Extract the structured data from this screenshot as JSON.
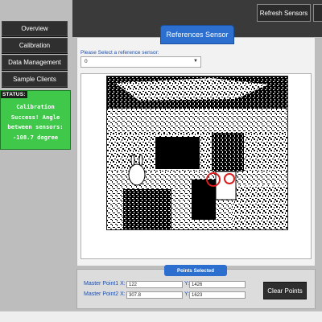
{
  "sidebar": {
    "items": [
      {
        "label": "Overview"
      },
      {
        "label": "Calibration"
      },
      {
        "label": "Data Management"
      },
      {
        "label": "Sample Clients"
      }
    ],
    "status_label": "STATUS:",
    "status_message": "Calibration\nSuccess! Angle\nbetween sensors:\n-108.7 degree"
  },
  "toolbar": {
    "refresh_label": "Refresh Sensors"
  },
  "main": {
    "tab_label": "References Sensor",
    "select_label": "Please Select a reference sensor:",
    "select_value": "0"
  },
  "points": {
    "tab_label": "Points Selected",
    "p1_label": "Master Point1 X:",
    "p1_x": "122",
    "p1_y_label": "Y:",
    "p1_y": "1426",
    "p2_label": "Master Point2 X:",
    "p2_x": "307.8",
    "p2_y_label": "Y:",
    "p2_y": "1623",
    "clear_label": "Clear Points"
  },
  "colors": {
    "accent_blue": "#2c6fcf",
    "status_green": "#3fc84a",
    "dark_button": "#2f2f2f",
    "marker_red": "#d81b1b"
  }
}
